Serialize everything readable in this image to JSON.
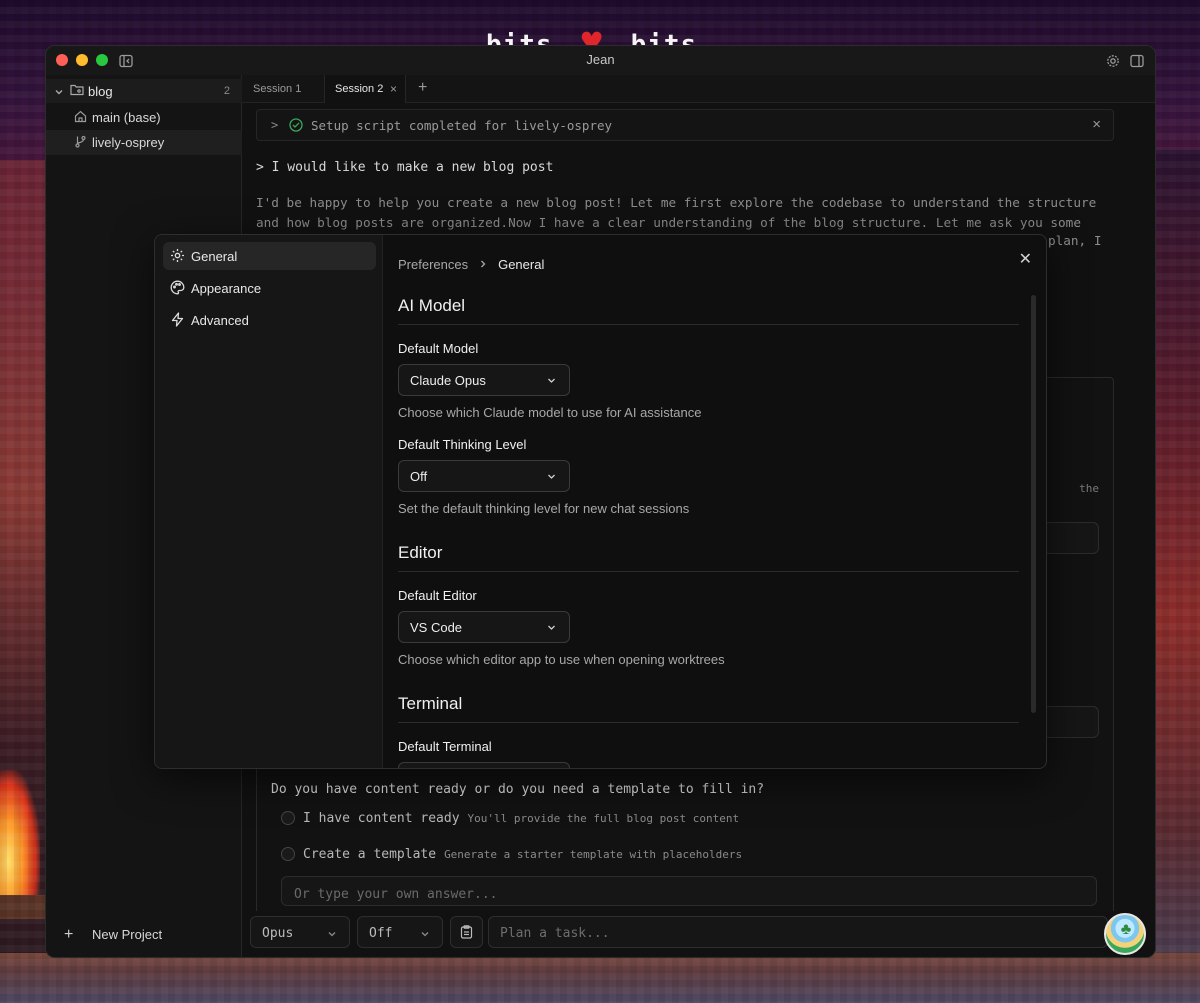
{
  "window": {
    "title": "Jean"
  },
  "wallpaper": {
    "banner_left": "bits",
    "banner_right": "bits"
  },
  "sidebar": {
    "project": {
      "name": "blog",
      "count": "2"
    },
    "worktrees": [
      {
        "label": "main (base)",
        "icon": "home-icon"
      },
      {
        "label": "lively-osprey",
        "icon": "git-branch-icon"
      }
    ],
    "new_project_label": "New Project"
  },
  "tabs": [
    {
      "label": "Session 1",
      "active": false
    },
    {
      "label": "Session 2",
      "active": true
    }
  ],
  "chat": {
    "setup_text": "Setup script completed for lively-osprey",
    "user_message": "> I would like to make a new blog post",
    "assistant_text": "I'd be happy to help you create a new blog post! Let me first explore the codebase to understand the structure and how blog posts are organized.Now I have a clear understanding of the blog structure. Let me ask you some",
    "assistant_fragment": "plan, I",
    "card_fragment": "the",
    "question": "Do you have content ready or do you need a template to fill in?",
    "options": [
      {
        "label": "I have content ready",
        "desc": "You'll provide the full blog post content"
      },
      {
        "label": "Create a template",
        "desc": "Generate a starter template with placeholders"
      }
    ],
    "own_answer_placeholder": "Or type your own answer..."
  },
  "composer": {
    "model_value": "Opus",
    "thinking_value": "Off",
    "input_placeholder": "Plan a task..."
  },
  "preferences": {
    "nav": [
      {
        "label": "General",
        "icon": "gear-icon",
        "active": true
      },
      {
        "label": "Appearance",
        "icon": "palette-icon",
        "active": false
      },
      {
        "label": "Advanced",
        "icon": "bolt-icon",
        "active": false
      }
    ],
    "breadcrumb": {
      "root": "Preferences",
      "current": "General"
    },
    "sections": {
      "ai_model": {
        "title": "AI Model",
        "default_model": {
          "label": "Default Model",
          "value": "Claude Opus",
          "help": "Choose which Claude model to use for AI assistance"
        },
        "default_thinking": {
          "label": "Default Thinking Level",
          "value": "Off",
          "help": "Set the default thinking level for new chat sessions"
        }
      },
      "editor": {
        "title": "Editor",
        "default_editor": {
          "label": "Default Editor",
          "value": "VS Code",
          "help": "Choose which editor app to use when opening worktrees"
        }
      },
      "terminal": {
        "title": "Terminal",
        "default_terminal": {
          "label": "Default Terminal"
        }
      }
    }
  }
}
